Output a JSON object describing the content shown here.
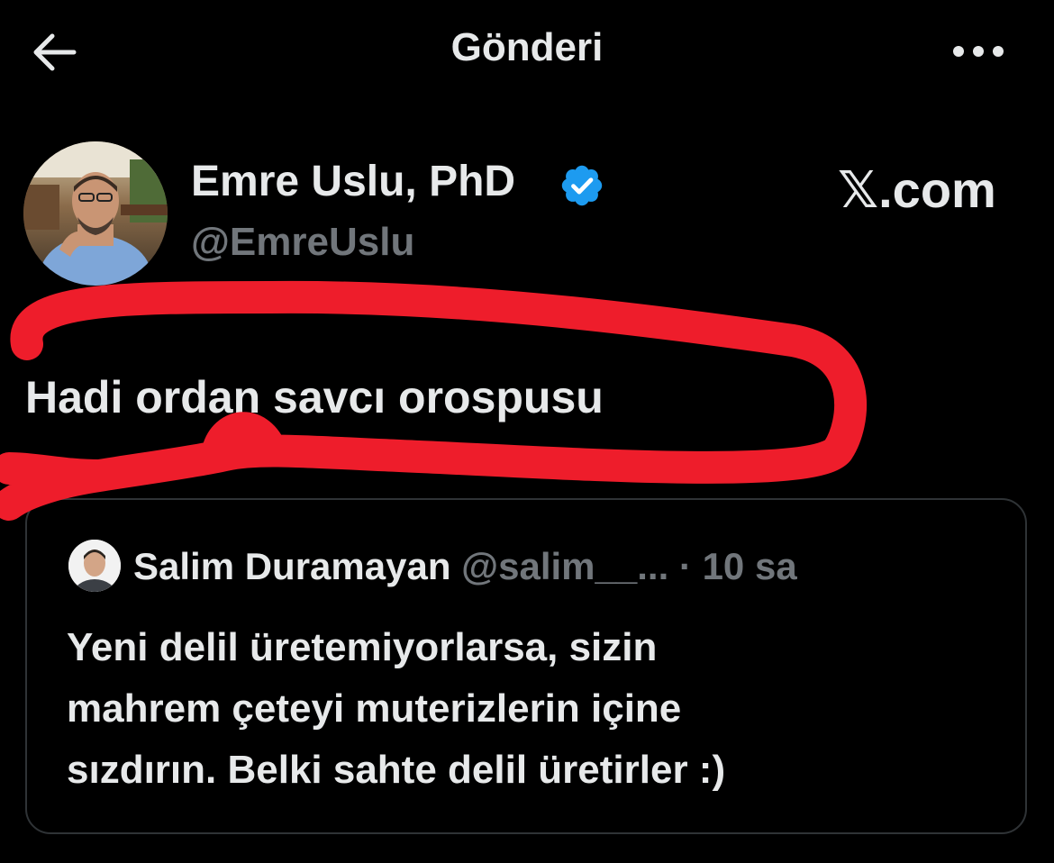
{
  "header": {
    "title": "Gönderi",
    "back_icon": "arrow-left-icon",
    "more_icon": "more-horizontal-icon"
  },
  "author": {
    "name": "Emre Uslu, PhD",
    "handle": "@EmreUslu",
    "verified_icon": "verified-badge-icon",
    "verified_color": "#1d9bf0"
  },
  "watermark": "𝕏.com",
  "tweet": {
    "text": "Hadi ordan savcı orospusu"
  },
  "quote": {
    "name": "Salim Duramayan",
    "handle": "@salim__...",
    "separator": " · ",
    "time": "10 sa",
    "lines": [
      "Yeni delil üretemiyorlarsa, sizin",
      "mahrem çeteyi muterizlerin içine",
      "sızdırın. Belki sahte delil üretirler :)"
    ]
  },
  "colors": {
    "background": "#000000",
    "text_primary": "#e7e9ea",
    "text_secondary": "#71767b",
    "border": "#2f3336",
    "annotation_red": "#ee1d2b"
  }
}
